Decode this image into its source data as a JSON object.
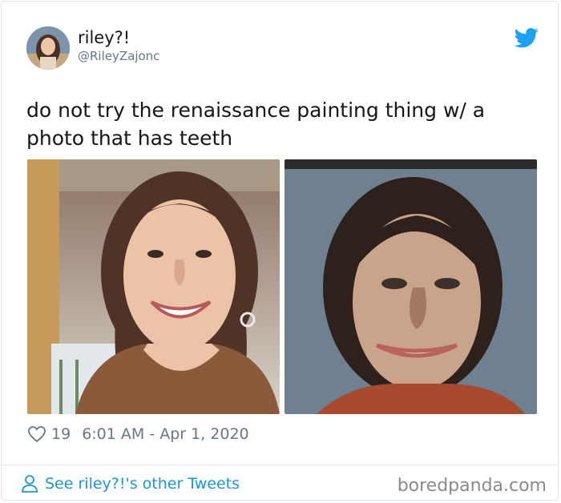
{
  "author": {
    "display_name": "riley?!",
    "handle": "@RileyZajonc"
  },
  "tweet": {
    "text": "do not try the renaissance painting thing w/ a photo that has teeth",
    "likes": "19",
    "timestamp": "6:01 AM - Apr 1, 2020"
  },
  "footer": {
    "see_other_label": "See riley?!'s other Tweets"
  },
  "watermark": "boredpanda.com",
  "colors": {
    "link_blue": "#1b95e0",
    "twitter_blue": "#1da1f2",
    "muted_gray": "#657786"
  },
  "icons": {
    "brand": "twitter-bird-icon",
    "like": "heart-icon",
    "profile": "person-icon"
  }
}
